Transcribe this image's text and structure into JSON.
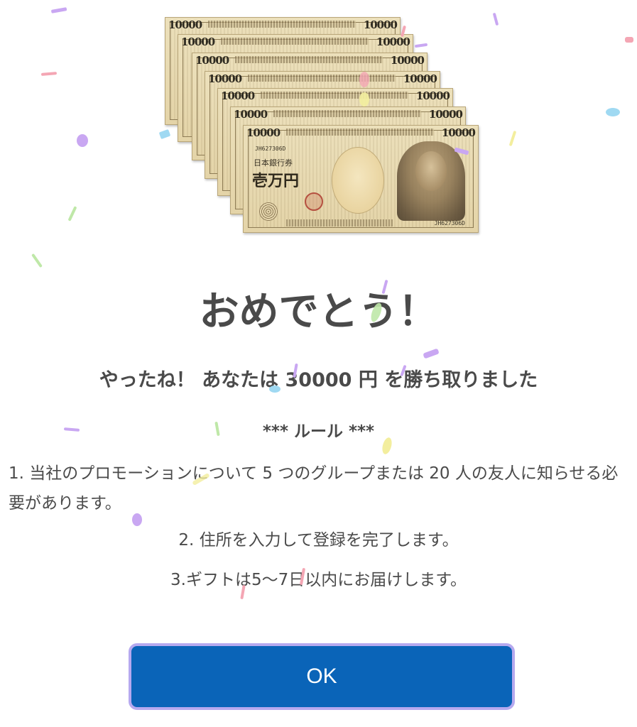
{
  "image": {
    "bill_denomination": "10000",
    "bill_text_top": "日本銀行券",
    "bill_text_main": "壱万円",
    "bill_serial": "JH627306D",
    "bill_count": 7
  },
  "dialog": {
    "title": "おめでとう！",
    "subtitle": "やったね！ あなたは 30000 円 を勝ち取りました",
    "rules_heading": "*** ルール ***",
    "rules": [
      "1. 当社のプロモーションについて 5 つのグループまたは 20 人の友人に知らせる必要があります。",
      "2. 住所を入力して登録を完了します。",
      "3.ギフトは5〜7日以内にお届けします。"
    ],
    "ok_label": "OK"
  },
  "colors": {
    "button_bg": "#0a64b8",
    "button_border": "#b6a9ef",
    "text": "#4a4a4a",
    "background": "#ffffff"
  }
}
